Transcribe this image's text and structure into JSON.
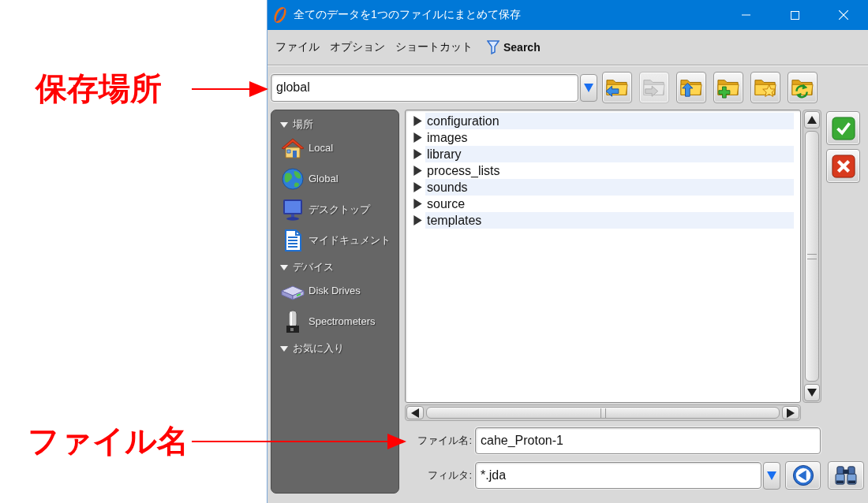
{
  "window": {
    "title": "全てのデータを1つのファイルにまとめて保存"
  },
  "menu": [
    {
      "label": "ファイル",
      "kind": "text"
    },
    {
      "label": "オプション",
      "kind": "text"
    },
    {
      "label": "ショートカット",
      "kind": "text"
    },
    {
      "label": "Search",
      "kind": "filter"
    }
  ],
  "location": {
    "value": "global"
  },
  "toolbar": [
    {
      "kind": "back",
      "disabled": false
    },
    {
      "kind": "forward",
      "disabled": true
    },
    {
      "kind": "up",
      "disabled": false
    },
    {
      "kind": "new",
      "disabled": false
    },
    {
      "kind": "favorite",
      "disabled": false
    },
    {
      "kind": "refresh",
      "disabled": false
    }
  ],
  "sidebar": {
    "sections": [
      {
        "label": "場所",
        "expanded": true,
        "items": [
          {
            "label": "Local",
            "kind": "home"
          },
          {
            "label": "Global",
            "kind": "globe"
          },
          {
            "label": "デスクトップ",
            "kind": "monitor"
          },
          {
            "label": "マイドキュメント",
            "kind": "document"
          }
        ]
      },
      {
        "label": "デバイス",
        "expanded": true,
        "items": [
          {
            "label": "Disk Drives",
            "kind": "drive"
          },
          {
            "label": "Spectrometers",
            "kind": "spectrometer"
          }
        ]
      },
      {
        "label": "お気に入り",
        "expanded": true
      }
    ]
  },
  "folders": [
    {
      "name": "configuration",
      "expanded": false
    },
    {
      "name": "images",
      "expanded": false
    },
    {
      "name": "library",
      "expanded": false
    },
    {
      "name": "process_lists",
      "expanded": false
    },
    {
      "name": "sounds",
      "expanded": false
    },
    {
      "name": "source",
      "expanded": false
    },
    {
      "name": "templates",
      "expanded": false
    }
  ],
  "actions": [
    {
      "kind": "ok"
    },
    {
      "kind": "cancel"
    }
  ],
  "file_name": {
    "label": "ファイル名:",
    "value": "cahe_Proton-1"
  },
  "filter": {
    "label": "フィルタ:",
    "value": "*.jda",
    "buttons": [
      {
        "kind": "back"
      },
      {
        "kind": "find"
      }
    ]
  },
  "annotations": [
    {
      "label": "保存場所"
    },
    {
      "label": "ファイル名"
    }
  ]
}
